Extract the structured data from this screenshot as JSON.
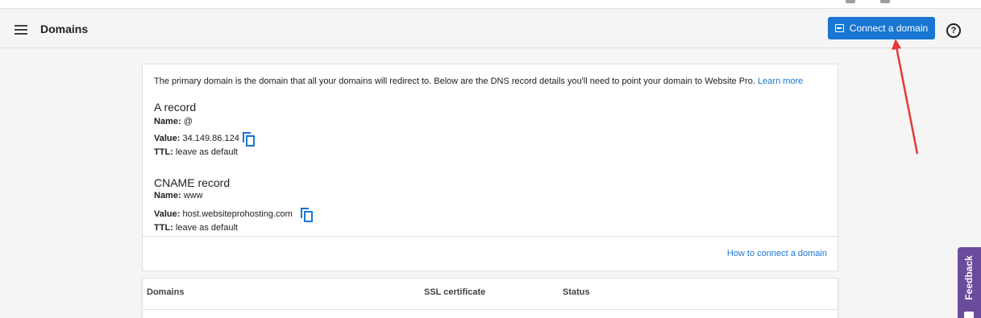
{
  "header": {
    "title": "Domains",
    "connect_button_label": "Connect a domain",
    "help_icon_glyph": "?"
  },
  "intro": {
    "text": "The primary domain is the domain that all your domains will redirect to. Below are the DNS record details you'll need to point your domain to Website Pro.",
    "link_label": "Learn more"
  },
  "a_record": {
    "title": "A record",
    "name_label": "Name:",
    "name_value": "@",
    "value_label": "Value:",
    "value_value": "34.149.86.124",
    "ttl_label": "TTL:",
    "ttl_value": "leave as default"
  },
  "cname_record": {
    "title": "CNAME record",
    "name_label": "Name:",
    "name_value": "www",
    "value_label": "Value:",
    "value_value": "host.websiteprohosting.com",
    "ttl_label": "TTL:",
    "ttl_value": "leave as default"
  },
  "howto_link": "How to connect a domain",
  "table": {
    "columns": [
      "Domains",
      "SSL certificate",
      "Status"
    ]
  },
  "feedback_label": "Feedback",
  "colors": {
    "accent": "#1976d2",
    "annotation_arrow": "#e53935",
    "feedback_tab": "#6a4c9c"
  }
}
